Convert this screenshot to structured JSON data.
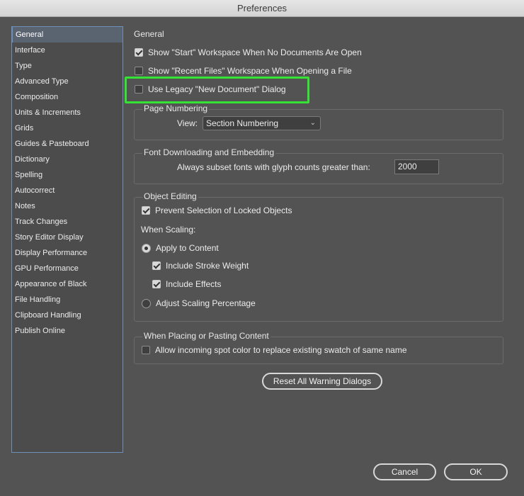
{
  "window": {
    "title": "Preferences"
  },
  "sidebar": {
    "items": [
      {
        "label": "General",
        "selected": true
      },
      {
        "label": "Interface"
      },
      {
        "label": "Type"
      },
      {
        "label": "Advanced Type"
      },
      {
        "label": "Composition"
      },
      {
        "label": "Units & Increments"
      },
      {
        "label": "Grids"
      },
      {
        "label": "Guides & Pasteboard"
      },
      {
        "label": "Dictionary"
      },
      {
        "label": "Spelling"
      },
      {
        "label": "Autocorrect"
      },
      {
        "label": "Notes"
      },
      {
        "label": "Track Changes"
      },
      {
        "label": "Story Editor Display"
      },
      {
        "label": "Display Performance"
      },
      {
        "label": "GPU Performance"
      },
      {
        "label": "Appearance of Black"
      },
      {
        "label": "File Handling"
      },
      {
        "label": "Clipboard Handling"
      },
      {
        "label": "Publish Online"
      }
    ]
  },
  "general": {
    "title": "General",
    "show_start": {
      "label": "Show \"Start\" Workspace When No Documents Are Open",
      "checked": true
    },
    "show_recent": {
      "label": "Show \"Recent Files\" Workspace When Opening a File",
      "checked": false
    },
    "legacy_dialog": {
      "label": "Use Legacy \"New Document\" Dialog",
      "checked": false
    }
  },
  "page_numbering": {
    "legend": "Page Numbering",
    "view_label": "View:",
    "view_value": "Section Numbering"
  },
  "font_downloading": {
    "legend": "Font Downloading and Embedding",
    "subset_label": "Always subset fonts with glyph counts greater than:",
    "subset_value": "2000"
  },
  "object_editing": {
    "legend": "Object Editing",
    "prevent_locked": {
      "label": "Prevent Selection of Locked Objects",
      "checked": true
    },
    "when_scaling": "When Scaling:",
    "apply_to_content": {
      "label": "Apply to Content",
      "selected": true
    },
    "include_stroke": {
      "label": "Include Stroke Weight",
      "checked": true
    },
    "include_effects": {
      "label": "Include Effects",
      "checked": true
    },
    "adjust_scaling": {
      "label": "Adjust Scaling Percentage",
      "selected": false
    }
  },
  "placing": {
    "legend": "When Placing or Pasting Content",
    "allow_spot": {
      "label": "Allow incoming spot color to replace existing swatch of same name",
      "checked": false
    }
  },
  "buttons": {
    "reset_warnings": "Reset All Warning Dialogs",
    "cancel": "Cancel",
    "ok": "OK"
  },
  "colors": {
    "highlight": "#35e335",
    "panel": "#535353",
    "selection": "#5a6370"
  }
}
